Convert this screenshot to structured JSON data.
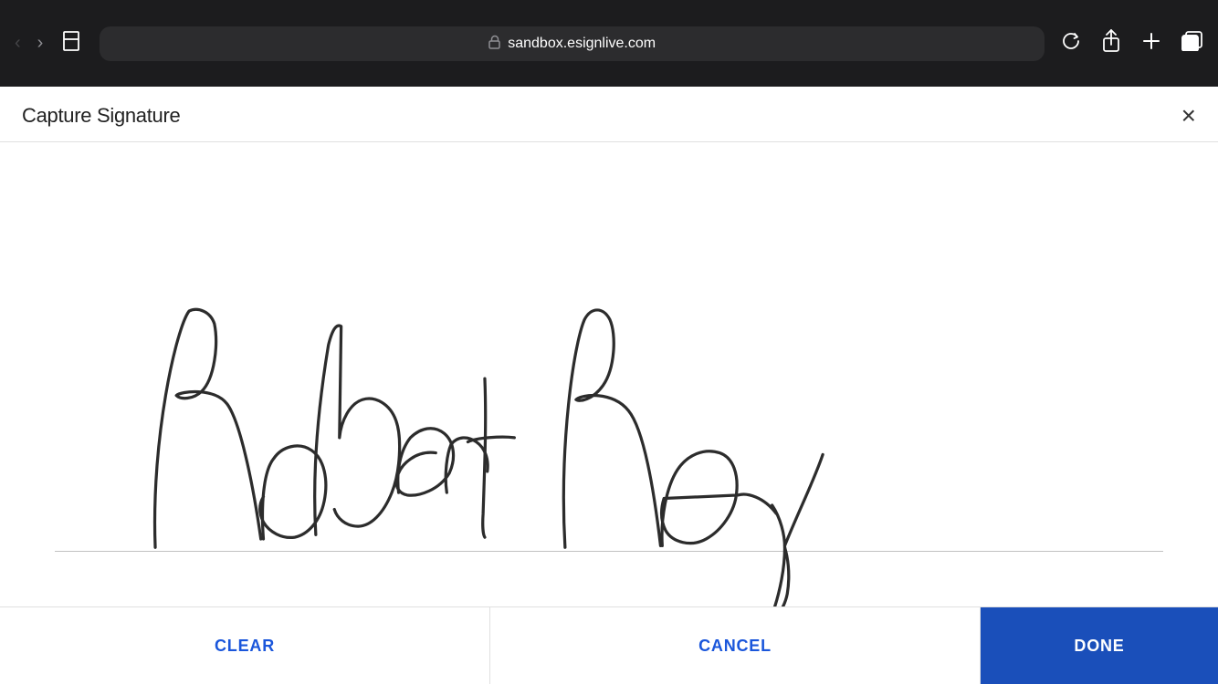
{
  "browser": {
    "url": "sandbox.esignlive.com",
    "url_full": "sandbox.esignlive.com"
  },
  "modal": {
    "title": "Capture Signature",
    "close_label": "×",
    "signature_name": "Robert Ray"
  },
  "footer": {
    "clear_label": "CLEAR",
    "cancel_label": "CANCEL",
    "done_label": "DONE"
  }
}
